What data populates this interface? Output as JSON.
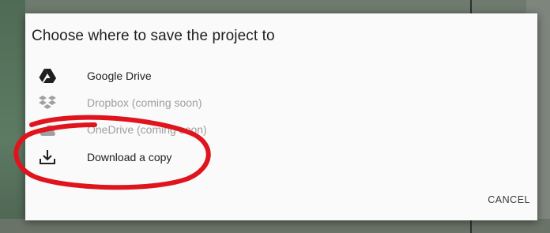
{
  "dialog": {
    "title": "Choose where to save the project to",
    "options": [
      {
        "label": "Google Drive",
        "icon": "google-drive-icon",
        "enabled": true
      },
      {
        "label": "Dropbox (coming soon)",
        "icon": "dropbox-icon",
        "enabled": false
      },
      {
        "label": "OneDrive (coming soon)",
        "icon": "onedrive-icon",
        "enabled": false
      },
      {
        "label": "Download a copy",
        "icon": "download-icon",
        "enabled": true
      }
    ],
    "cancel_label": "CANCEL"
  },
  "colors": {
    "annotation_circle": "#e0141c",
    "enabled_text": "#212121",
    "disabled_text": "#9e9e9e"
  }
}
